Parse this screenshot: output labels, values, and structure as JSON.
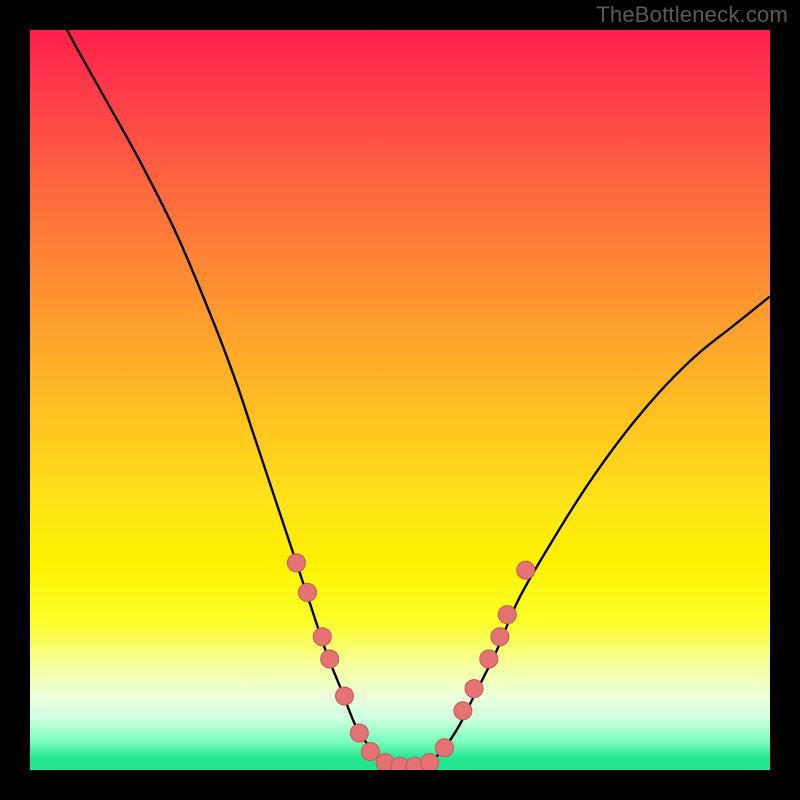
{
  "watermark": "TheBottleneck.com",
  "colors": {
    "curve": "#000000",
    "marker_fill": "#e57373",
    "marker_stroke": "#c45858",
    "background_black": "#000000"
  },
  "chart_data": {
    "type": "line",
    "title": "",
    "xlabel": "",
    "ylabel": "",
    "xlim": [
      0,
      100
    ],
    "ylim": [
      0,
      100
    ],
    "grid": false,
    "legend": false,
    "series": [
      {
        "name": "bottleneck-curve",
        "x": [
          0,
          5,
          10,
          15,
          20,
          25,
          28,
          30,
          32,
          34,
          36,
          38,
          40,
          42,
          44,
          46,
          48,
          50,
          52,
          54,
          56,
          58,
          60,
          63,
          66,
          70,
          75,
          80,
          85,
          90,
          95,
          100
        ],
        "y": [
          110,
          100,
          91,
          82,
          72,
          60,
          52,
          46,
          40,
          34,
          28,
          22,
          16,
          11,
          6,
          3,
          1,
          0.5,
          0.5,
          1,
          3,
          6,
          10,
          16,
          23,
          30,
          38,
          45,
          51,
          56,
          60,
          64
        ]
      }
    ],
    "markers": {
      "name": "highlight-points",
      "x": [
        36.0,
        37.5,
        39.5,
        40.5,
        42.5,
        44.5,
        46.0,
        48.0,
        50.0,
        52.0,
        54.0,
        56.0,
        58.5,
        60.0,
        62.0,
        63.5,
        64.5,
        67.0
      ],
      "y": [
        28.0,
        24.0,
        18.0,
        15.0,
        10.0,
        5.0,
        2.5,
        1.0,
        0.5,
        0.5,
        1.0,
        3.0,
        8.0,
        11.0,
        15.0,
        18.0,
        21.0,
        27.0
      ],
      "r": 9
    }
  }
}
